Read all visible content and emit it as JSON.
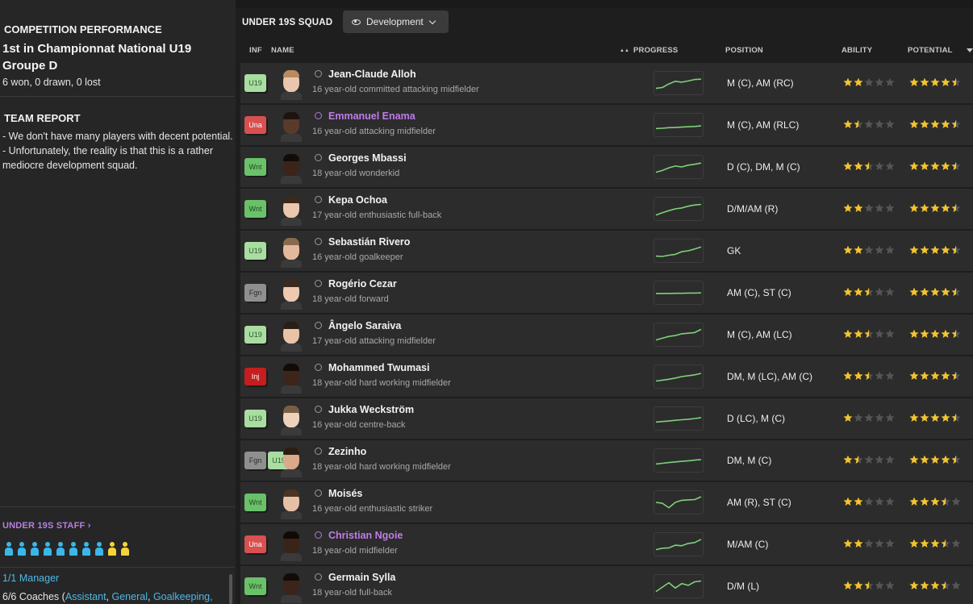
{
  "competition": {
    "section_title": "COMPETITION PERFORMANCE",
    "standing": "1st in Championnat National U19 Groupe D",
    "record": "6 won, 0 drawn, 0 lost"
  },
  "team_report": {
    "section_title": "TEAM REPORT",
    "line1": "- We don't have many players with decent potential.",
    "line2": "- Unfortunately, the reality is that this is a rather mediocre development squad."
  },
  "staff": {
    "title": "UNDER 19S STAFF",
    "chevron": "›",
    "icons": [
      "blue",
      "blue",
      "blue",
      "blue",
      "blue",
      "blue",
      "blue",
      "blue",
      "yellow",
      "yellow"
    ],
    "manager": "1/1 Manager",
    "coaches_prefix": "6/6 Coaches (",
    "coach_links": [
      "Assistant",
      "General",
      "Goalkeeping,"
    ]
  },
  "header": {
    "squad_title": "UNDER 19S SQUAD",
    "view_label": "Development",
    "columns": {
      "inf": "INF",
      "name": "NAME",
      "progress": "PROGRESS",
      "position": "POSITION",
      "ability": "ABILITY",
      "potential": "POTENTIAL"
    }
  },
  "colors": {
    "accent_purple": "#c17be8",
    "link_blue": "#4fb8e6",
    "star_gold": "#f4c430",
    "progress_green": "#7fd07a"
  },
  "players": [
    {
      "inf": [
        "U19"
      ],
      "inf_type": [
        "u19"
      ],
      "name": "Jean-Claude Alloh",
      "desc": "16 year-old committed attacking midfielder",
      "position": "M (C), AM (RC)",
      "ability": 2,
      "potential": 4.5,
      "pot_last_white": true,
      "skin": "#e9c6ad",
      "hair": "#b98a5e",
      "highlight": false,
      "progress": [
        0.2,
        0.25,
        0.45,
        0.6,
        0.55,
        0.62,
        0.7,
        0.72
      ]
    },
    {
      "inf": [
        "Una"
      ],
      "inf_type": [
        "una"
      ],
      "name": "Emmanuel Enama",
      "desc": "16 year-old attacking midfielder",
      "position": "M (C), AM (RLC)",
      "ability": 1.5,
      "potential": 4.5,
      "pot_last_white": true,
      "skin": "#5a3b2a",
      "hair": "#1c1410",
      "highlight": true,
      "progress": [
        0.3,
        0.32,
        0.35,
        0.36,
        0.38,
        0.4,
        0.42,
        0.45
      ]
    },
    {
      "inf": [
        "Wnt"
      ],
      "inf_type": [
        "wnt"
      ],
      "name": "Georges Mbassi",
      "desc": "18 year-old wonderkid",
      "position": "D (C), DM, M (C)",
      "ability": 2.5,
      "potential": 4.5,
      "pot_last_white": true,
      "skin": "#3b2418",
      "hair": "#120c08",
      "highlight": false,
      "progress": [
        0.2,
        0.3,
        0.45,
        0.55,
        0.5,
        0.6,
        0.65,
        0.72
      ]
    },
    {
      "inf": [
        "Wnt"
      ],
      "inf_type": [
        "wnt"
      ],
      "name": "Kepa Ochoa",
      "desc": "17 year-old enthusiastic full-back",
      "position": "D/M/AM (R)",
      "ability": 2,
      "potential": 4.5,
      "pot_last_white": true,
      "skin": "#ebc7ae",
      "hair": "#3a2a1c",
      "highlight": false,
      "progress": [
        0.15,
        0.28,
        0.4,
        0.5,
        0.55,
        0.65,
        0.72,
        0.75
      ]
    },
    {
      "inf": [
        "U19"
      ],
      "inf_type": [
        "u19"
      ],
      "name": "Sebastián Rivero",
      "desc": "16 year-old goalkeeper",
      "position": "GK",
      "ability": 2,
      "potential": 4.5,
      "pot_last_white": true,
      "skin": "#e3b99c",
      "hair": "#8a6a4c",
      "highlight": false,
      "progress": [
        0.2,
        0.18,
        0.25,
        0.3,
        0.45,
        0.5,
        0.6,
        0.72
      ]
    },
    {
      "inf": [
        "Fgn"
      ],
      "inf_type": [
        "fgn"
      ],
      "name": "Rogério Cezar",
      "desc": "18 year-old forward",
      "position": "AM (C), ST (C)",
      "ability": 2.5,
      "potential": 4.5,
      "pot_last_white": true,
      "skin": "#edc9b0",
      "hair": "#3b2a1d",
      "highlight": false,
      "progress": [
        0.45,
        0.46,
        0.46,
        0.47,
        0.47,
        0.48,
        0.48,
        0.49
      ]
    },
    {
      "inf": [
        "U19"
      ],
      "inf_type": [
        "u19"
      ],
      "name": "Ângelo Saraiva",
      "desc": "17 year-old attacking midfielder",
      "position": "M (C), AM (LC)",
      "ability": 2.5,
      "potential": 4.5,
      "pot_last_white": true,
      "skin": "#e9c3a8",
      "hair": "#2a1e16",
      "highlight": false,
      "progress": [
        0.2,
        0.3,
        0.4,
        0.45,
        0.55,
        0.58,
        0.62,
        0.8
      ]
    },
    {
      "inf": [
        "Inj"
      ],
      "inf_type": [
        "inj"
      ],
      "name": "Mohammed Twumasi",
      "desc": "18 year-old hard working midfielder",
      "position": "DM, M (LC), AM (C)",
      "ability": 2.5,
      "potential": 4.5,
      "pot_last_white": true,
      "skin": "#3d2519",
      "hair": "#110b07",
      "highlight": false,
      "progress": [
        0.25,
        0.3,
        0.35,
        0.42,
        0.5,
        0.55,
        0.6,
        0.68
      ]
    },
    {
      "inf": [
        "U19"
      ],
      "inf_type": [
        "u19"
      ],
      "name": "Jukka Weckström",
      "desc": "16 year-old centre-back",
      "position": "D (LC), M (C)",
      "ability": 1,
      "potential": 4.5,
      "pot_last_white": true,
      "skin": "#eed1bb",
      "hair": "#7a5e44",
      "highlight": false,
      "progress": [
        0.3,
        0.33,
        0.36,
        0.4,
        0.43,
        0.46,
        0.5,
        0.55
      ]
    },
    {
      "inf": [
        "Fgn",
        "U19"
      ],
      "inf_type": [
        "fgn",
        "u19"
      ],
      "name": "Zezinho",
      "desc": "18 year-old hard working midfielder",
      "position": "DM, M (C)",
      "ability": 1.5,
      "potential": 4.5,
      "pot_last_white": true,
      "skin": "#d9a98a",
      "hair": "#2a1d14",
      "highlight": false,
      "progress": [
        0.3,
        0.34,
        0.38,
        0.42,
        0.45,
        0.48,
        0.52,
        0.55
      ]
    },
    {
      "inf": [
        "Wnt"
      ],
      "inf_type": [
        "wnt"
      ],
      "name": "Moisés",
      "desc": "16 year-old enthusiastic striker",
      "position": "AM (R), ST (C)",
      "ability": 2,
      "potential": 3.5,
      "pot_last_white": false,
      "skin": "#e6c0a5",
      "hair": "#4a3424",
      "highlight": false,
      "progress": [
        0.5,
        0.45,
        0.2,
        0.5,
        0.62,
        0.64,
        0.66,
        0.82
      ]
    },
    {
      "inf": [
        "Una"
      ],
      "inf_type": [
        "una"
      ],
      "name": "Christian Ngoie",
      "desc": "18 year-old midfielder",
      "position": "M/AM (C)",
      "ability": 2,
      "potential": 3.5,
      "pot_last_white": false,
      "skin": "#3a2318",
      "hair": "#100a06",
      "highlight": true,
      "progress": [
        0.2,
        0.28,
        0.3,
        0.45,
        0.42,
        0.55,
        0.6,
        0.78
      ]
    },
    {
      "inf": [
        "Wnt"
      ],
      "inf_type": [
        "wnt"
      ],
      "name": "Germain Sylla",
      "desc": "18 year-old full-back",
      "position": "D/M (L)",
      "ability": 2.5,
      "potential": 3.5,
      "pot_last_white": false,
      "skin": "#3c241a",
      "hair": "#120b07",
      "highlight": false,
      "progress": [
        0.2,
        0.45,
        0.7,
        0.4,
        0.65,
        0.55,
        0.75,
        0.8
      ]
    }
  ]
}
